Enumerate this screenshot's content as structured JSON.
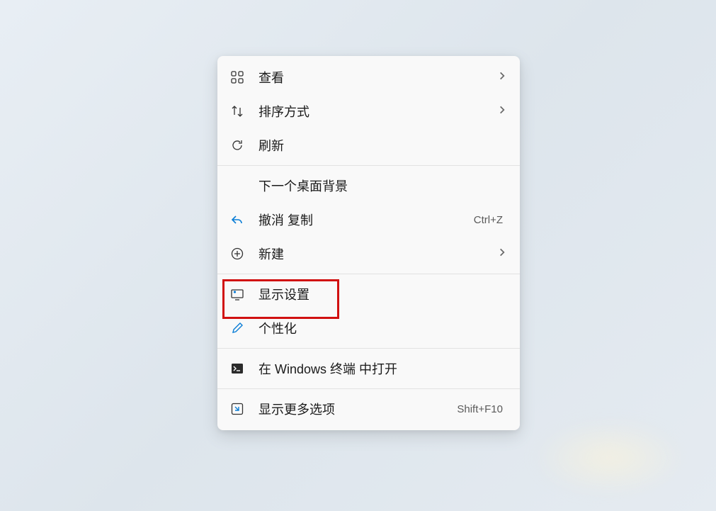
{
  "menu": {
    "items": [
      {
        "id": "view",
        "label": "查看",
        "icon": "grid-icon",
        "hasSubmenu": true
      },
      {
        "id": "sort",
        "label": "排序方式",
        "icon": "sort-icon",
        "hasSubmenu": true
      },
      {
        "id": "refresh",
        "label": "刷新",
        "icon": "refresh-icon"
      },
      {
        "divider": true
      },
      {
        "id": "next-bg",
        "label": "下一个桌面背景",
        "icon": null
      },
      {
        "id": "undo",
        "label": "撤消 复制",
        "icon": "undo-icon",
        "shortcut": "Ctrl+Z"
      },
      {
        "id": "new",
        "label": "新建",
        "icon": "plus-circle-icon",
        "hasSubmenu": true
      },
      {
        "divider": true
      },
      {
        "id": "display",
        "label": "显示设置",
        "icon": "display-settings-icon",
        "highlighted": true
      },
      {
        "id": "personalize",
        "label": "个性化",
        "icon": "paintbrush-icon"
      },
      {
        "divider": true
      },
      {
        "id": "terminal",
        "label": "在 Windows 终端 中打开",
        "icon": "terminal-icon"
      },
      {
        "divider": true
      },
      {
        "id": "more",
        "label": "显示更多选项",
        "icon": "more-options-icon",
        "shortcut": "Shift+F10"
      }
    ]
  }
}
